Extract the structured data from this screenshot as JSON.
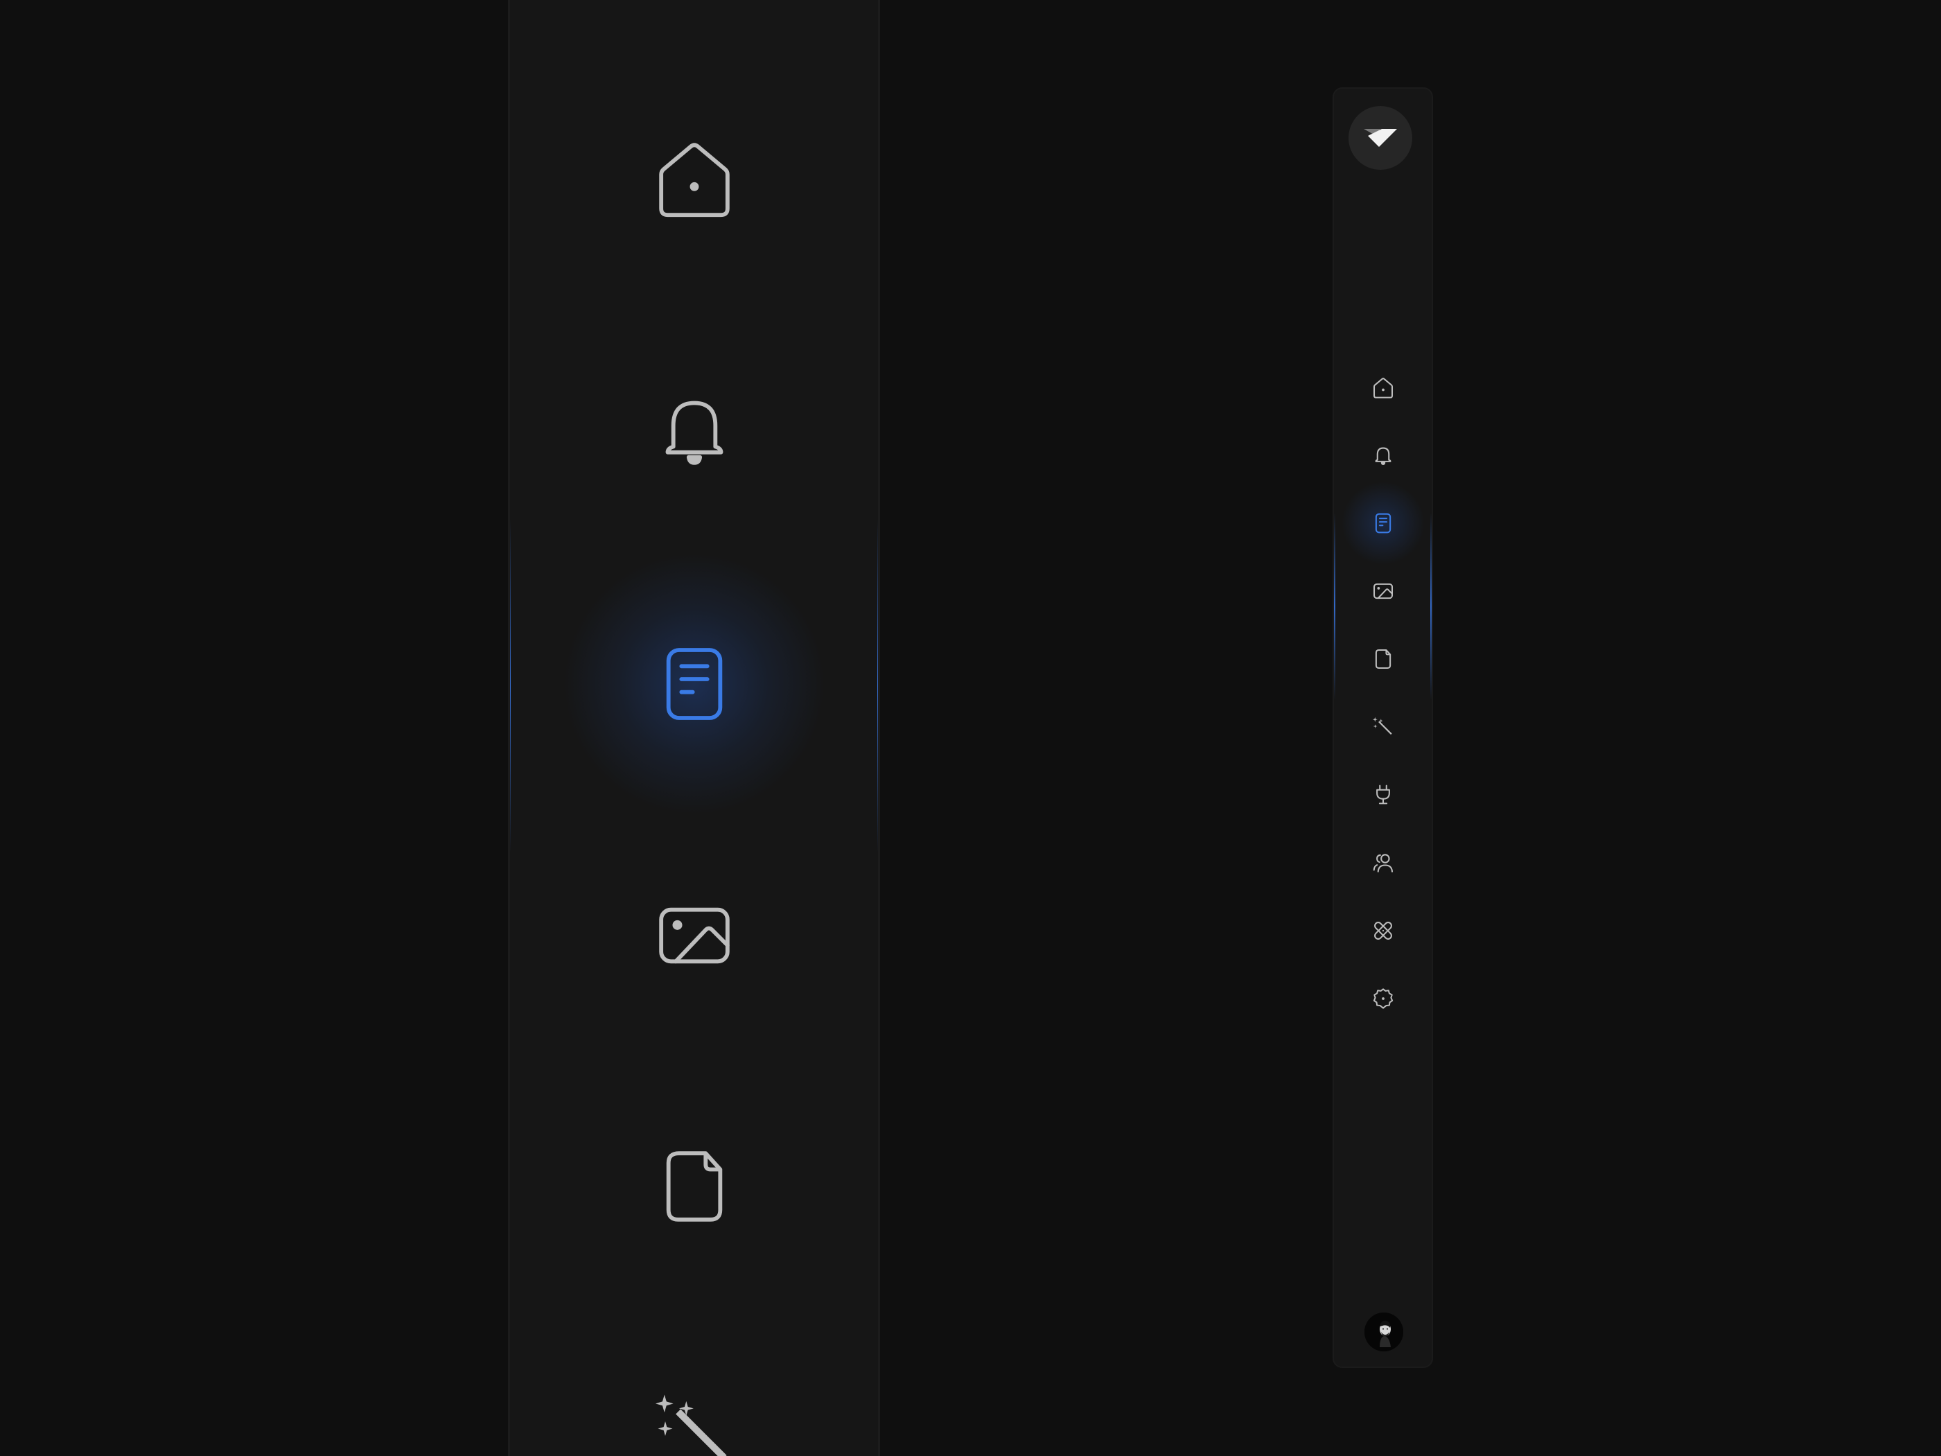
{
  "colors": {
    "background": "#0f0f0f",
    "panel": "#161616",
    "icon": "#bdbdbd",
    "accent": "#3a7be6",
    "logo_bg": "#262626"
  },
  "brand": {
    "logo_icon": "tilted-check-logo"
  },
  "zoom_preview": {
    "items": [
      {
        "icon": "home-icon",
        "active": false
      },
      {
        "icon": "bell-icon",
        "active": false
      },
      {
        "icon": "document-icon",
        "active": true
      },
      {
        "icon": "image-icon",
        "active": false
      },
      {
        "icon": "file-icon",
        "active": false
      },
      {
        "icon": "magic-wand-icon",
        "active": false
      }
    ]
  },
  "sidebar": {
    "items": [
      {
        "icon": "home-icon",
        "active": false
      },
      {
        "icon": "bell-icon",
        "active": false
      },
      {
        "icon": "document-icon",
        "active": true
      },
      {
        "icon": "image-icon",
        "active": false
      },
      {
        "icon": "file-icon",
        "active": false
      },
      {
        "icon": "magic-wand-icon",
        "active": false
      },
      {
        "icon": "plug-icon",
        "active": false
      },
      {
        "icon": "users-icon",
        "active": false
      },
      {
        "icon": "bandage-icon",
        "active": false
      },
      {
        "icon": "settings-icon",
        "active": false
      }
    ],
    "avatar": "user-avatar"
  }
}
